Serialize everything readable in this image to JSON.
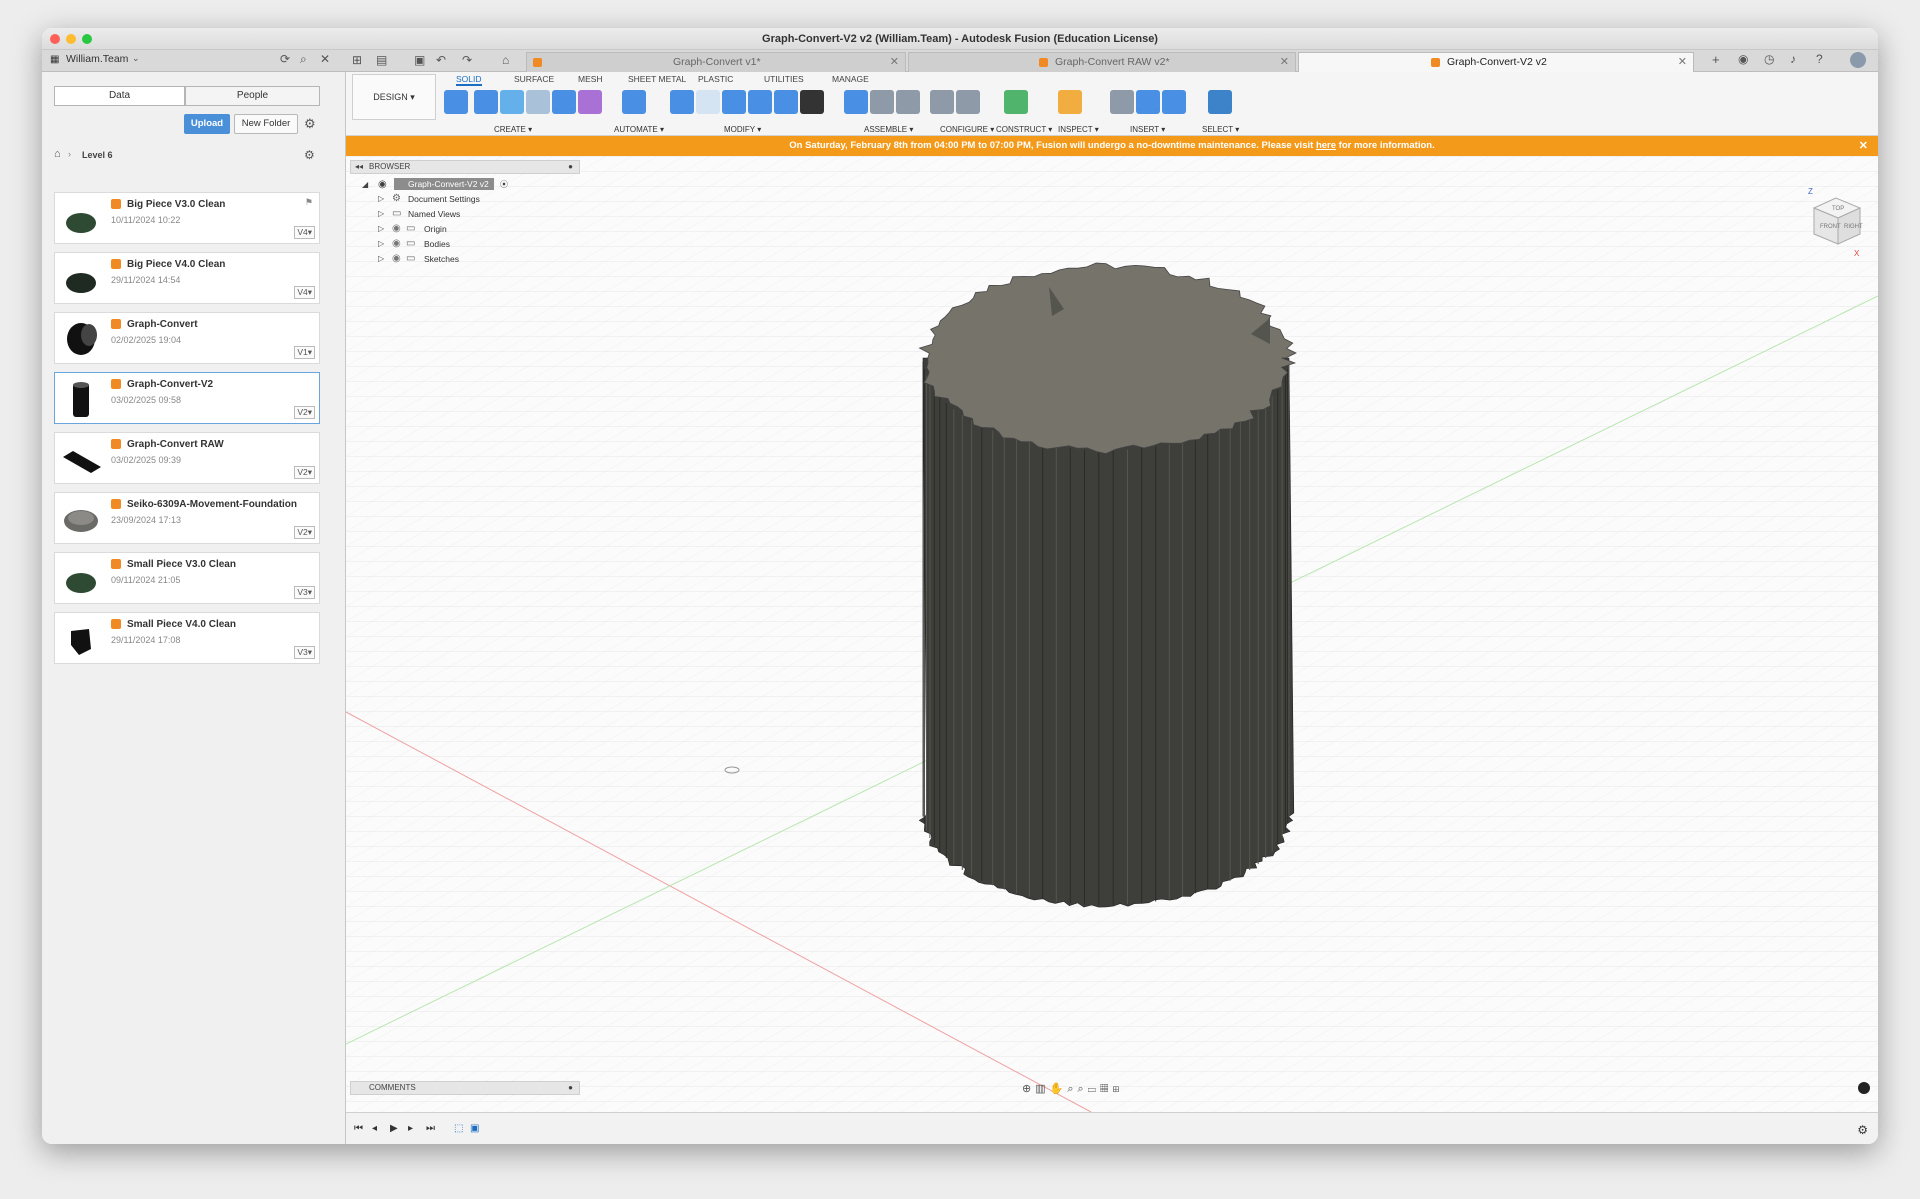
{
  "window": {
    "title": "Graph-Convert-V2 v2 (William.Team) - Autodesk Fusion (Education License)"
  },
  "tabs": [
    {
      "label": "Graph-Convert v1*"
    },
    {
      "label": "Graph-Convert RAW v2*"
    },
    {
      "label": "Graph-Convert-V2 v2"
    }
  ],
  "left": {
    "team": "William.Team",
    "data_tab": "Data",
    "people_tab": "People",
    "upload": "Upload",
    "new_folder": "New Folder",
    "breadcrumb": "Level 6",
    "files": [
      {
        "name": "Big Piece V3.0 Clean",
        "date": "10/11/2024 10:22",
        "ver": "V4"
      },
      {
        "name": "Big Piece V4.0 Clean",
        "date": "29/11/2024 14:54",
        "ver": "V4"
      },
      {
        "name": "Graph-Convert",
        "date": "02/02/2025 19:04",
        "ver": "V1"
      },
      {
        "name": "Graph-Convert-V2",
        "date": "03/02/2025 09:58",
        "ver": "V2"
      },
      {
        "name": "Graph-Convert RAW",
        "date": "03/02/2025 09:39",
        "ver": "V2"
      },
      {
        "name": "Seiko-6309A-Movement-Foundation",
        "date": "23/09/2024 17:13",
        "ver": "V2"
      },
      {
        "name": "Small Piece V3.0 Clean",
        "date": "09/11/2024 21:05",
        "ver": "V3"
      },
      {
        "name": "Small Piece V4.0 Clean",
        "date": "29/11/2024 17:08",
        "ver": "V3"
      }
    ]
  },
  "toolbar": {
    "workspace": "DESIGN",
    "tabs": [
      "SOLID",
      "SURFACE",
      "MESH",
      "SHEET METAL",
      "PLASTIC",
      "UTILITIES",
      "MANAGE"
    ],
    "groups": [
      "CREATE",
      "AUTOMATE",
      "MODIFY",
      "ASSEMBLE",
      "CONFIGURE",
      "CONSTRUCT",
      "INSPECT",
      "INSERT",
      "SELECT"
    ]
  },
  "banner": {
    "pre": "On Saturday, February 8th from 04:00 PM to 07:00 PM, Fusion will undergo a no-downtime maintenance. Please visit ",
    "link": "here",
    "post": " for more information."
  },
  "browser": {
    "title": "BROWSER",
    "root": "Graph-Convert-V2 v2",
    "items": [
      "Document Settings",
      "Named Views",
      "Origin",
      "Bodies",
      "Sketches"
    ]
  },
  "comments": "COMMENTS",
  "viewcube": {
    "top": "TOP",
    "front": "FRONT",
    "right": "RIGHT",
    "z": "Z",
    "x": "X"
  },
  "colors": {
    "accent": "#1b6fc2",
    "banner": "#f39a1a",
    "body": "#3e3f3b",
    "top_face": "#76736a"
  }
}
